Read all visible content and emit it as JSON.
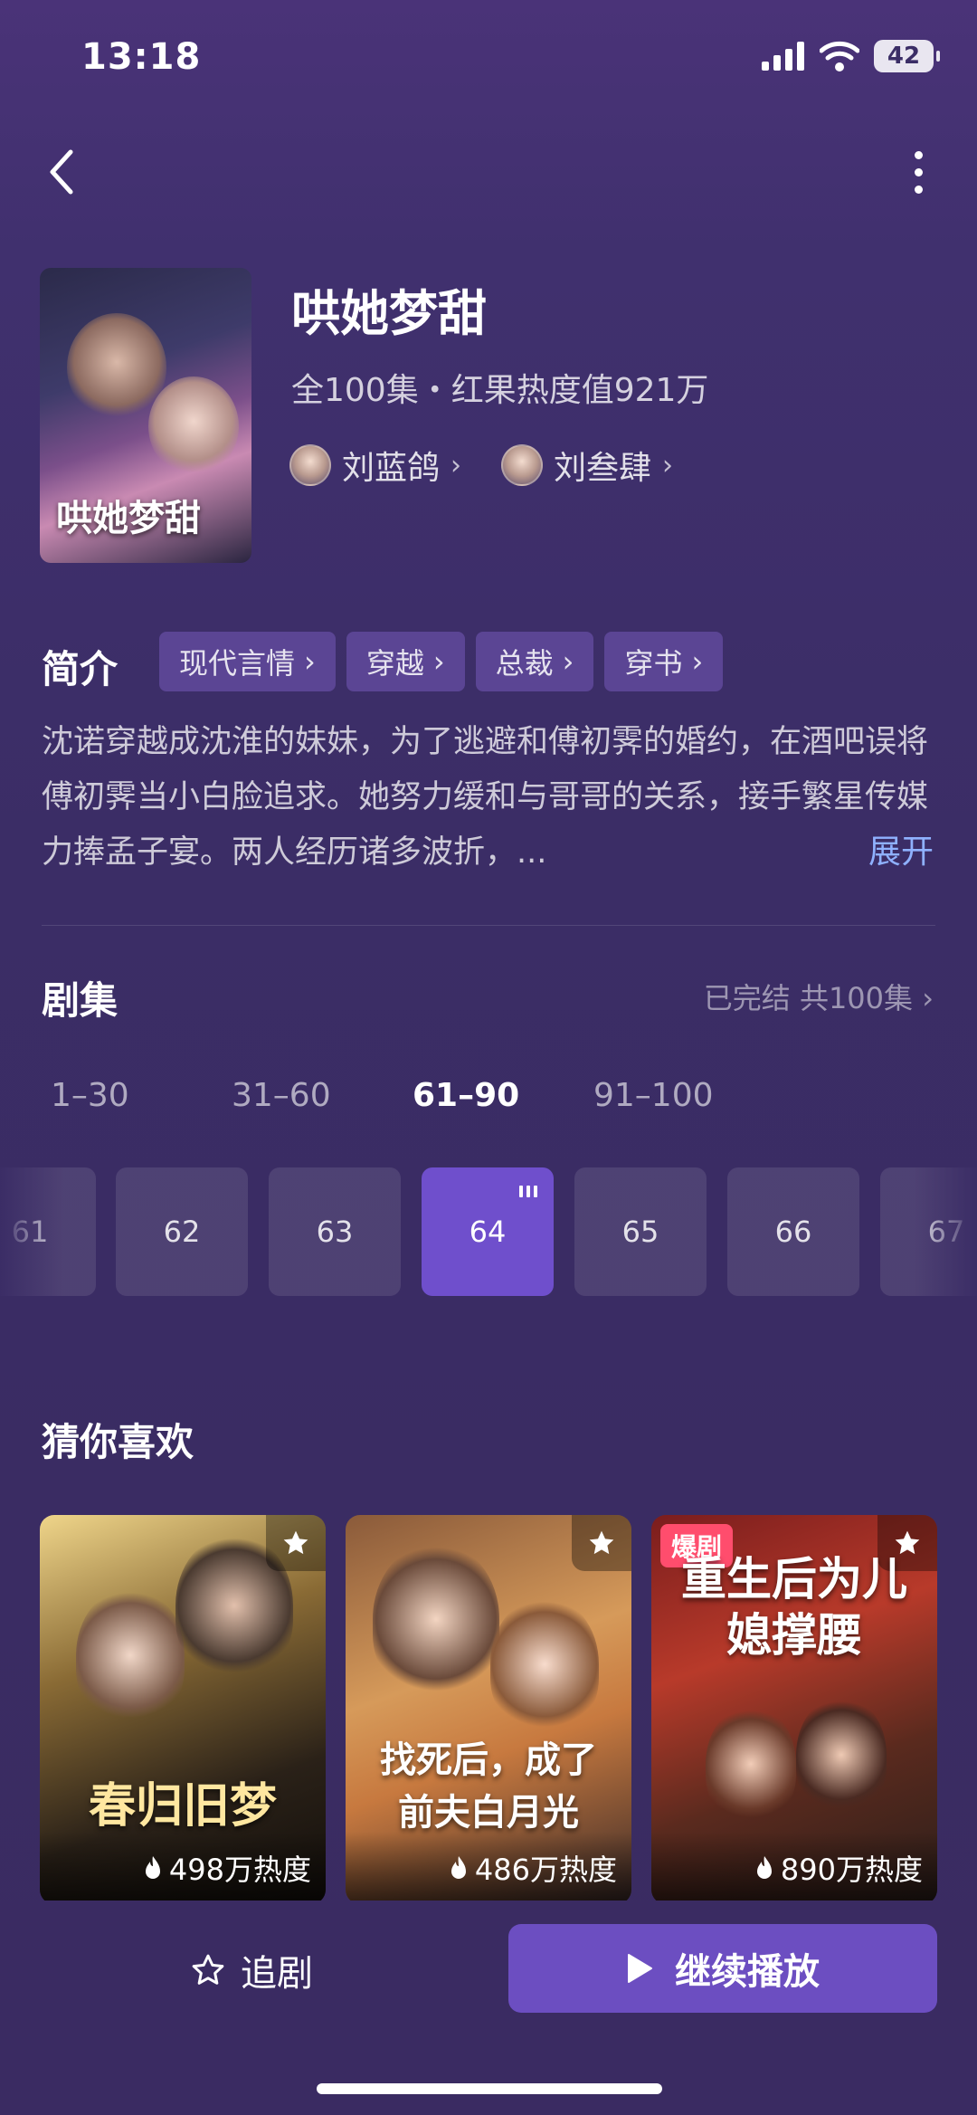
{
  "status_bar": {
    "time": "13:18",
    "battery": "42"
  },
  "drama": {
    "title": "哄她梦甜",
    "poster_title": "哄她梦甜",
    "meta": "全100集・红果热度值921万",
    "actors": [
      {
        "name": "刘蓝鸽"
      },
      {
        "name": "刘叁肆"
      }
    ]
  },
  "intro": {
    "label": "简介",
    "tags": [
      "现代言情",
      "穿越",
      "总裁",
      "穿书"
    ],
    "synopsis": "沈诺穿越成沈淮的妹妹，为了逃避和傅初霁的婚约，在酒吧误将傅初霁当小白脸追求。她努力缓和与哥哥的关系，接手繁星传媒力捧孟子宴。两人经历诸多波折，...",
    "expand_label": "展开"
  },
  "episodes": {
    "title": "剧集",
    "status": "已完结 共100集",
    "ranges": [
      "1–30",
      "31–60",
      "61–90",
      "91–100"
    ],
    "active_range": "61–90",
    "items": [
      "61",
      "62",
      "63",
      "64",
      "65",
      "66",
      "67"
    ],
    "playing": "64"
  },
  "recommend": {
    "title": "猜你喜欢",
    "cards": [
      {
        "art_title": "春归旧梦",
        "heat": "498万热度"
      },
      {
        "art_title": "找死后，成了前夫白月光",
        "heat": "486万热度"
      },
      {
        "art_title": "重生后为儿媳撑腰",
        "heat": "890万热度",
        "badge": "爆剧"
      }
    ]
  },
  "actions": {
    "follow_label": "追剧",
    "play_label": "继续播放"
  },
  "colors": {
    "accent": "#6c4ec1",
    "background": "#3b2d66",
    "link": "#8fb1ff",
    "hot_badge": "#ff4d6d"
  }
}
